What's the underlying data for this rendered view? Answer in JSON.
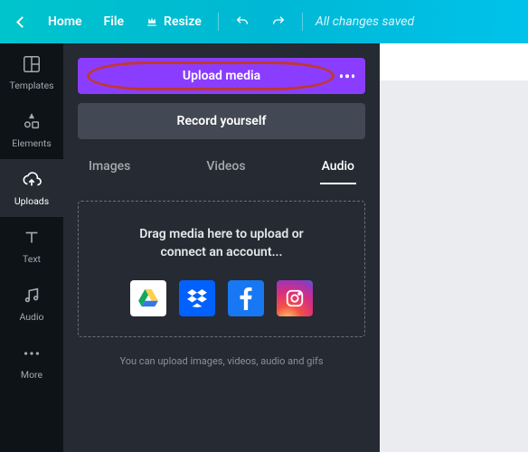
{
  "topbar": {
    "home": "Home",
    "file": "File",
    "resize": "Resize",
    "status": "All changes saved"
  },
  "rail": {
    "items": [
      {
        "label": "Templates"
      },
      {
        "label": "Elements"
      },
      {
        "label": "Uploads"
      },
      {
        "label": "Text"
      },
      {
        "label": "Audio"
      },
      {
        "label": "More"
      }
    ]
  },
  "panel": {
    "upload_label": "Upload media",
    "record_label": "Record yourself",
    "tabs": {
      "images": "Images",
      "videos": "Videos",
      "audio": "Audio"
    },
    "drop_line1": "Drag media here to upload or",
    "drop_line2": "connect an account...",
    "hint": "You can upload images, videos, audio and gifs"
  }
}
